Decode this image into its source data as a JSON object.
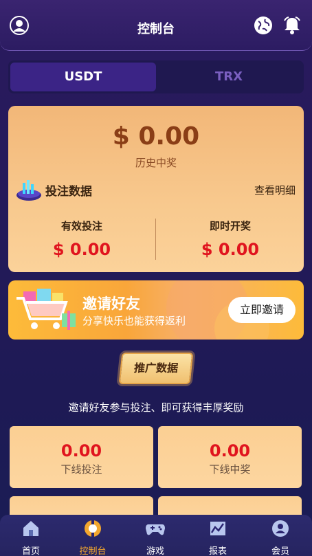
{
  "header": {
    "title": "控制台"
  },
  "tabs": [
    {
      "label": "USDT",
      "active": true
    },
    {
      "label": "TRX",
      "active": false
    }
  ],
  "summary": {
    "amount": "$ 0.00",
    "amount_label": "历史中奖",
    "bet_title": "投注数据",
    "detail_link": "查看明细",
    "stats": [
      {
        "label": "有效投注",
        "value": "$ 0.00"
      },
      {
        "label": "即时开奖",
        "value": "$ 0.00"
      }
    ]
  },
  "invite": {
    "title": "邀请好友",
    "subtitle": "分享快乐也能获得返利",
    "button": "立即邀请"
  },
  "promo": {
    "badge": "推广数据",
    "text": "邀请好友参与投注、即可获得丰厚奖励",
    "stats": [
      {
        "value": "0.00",
        "label": "下线投注"
      },
      {
        "value": "0.00",
        "label": "下线中奖"
      }
    ]
  },
  "nav": [
    {
      "label": "首页",
      "icon": "home-icon",
      "active": false
    },
    {
      "label": "控制台",
      "icon": "console-icon",
      "active": true
    },
    {
      "label": "游戏",
      "icon": "gamepad-icon",
      "active": false
    },
    {
      "label": "报表",
      "icon": "chart-icon",
      "active": false
    },
    {
      "label": "会员",
      "icon": "user-icon",
      "active": false
    }
  ],
  "colors": {
    "accent": "#f3a72e",
    "value_red": "#e0141e",
    "bg": "#241a5a"
  }
}
